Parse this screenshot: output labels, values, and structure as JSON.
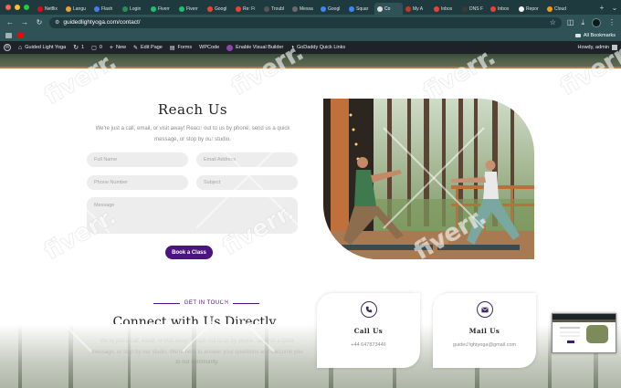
{
  "browser": {
    "tabs": [
      {
        "label": "Netflix",
        "color": "#e50914"
      },
      {
        "label": "Langu",
        "color": "#e8a33b"
      },
      {
        "label": "Flash",
        "color": "#4b7bec"
      },
      {
        "label": "Login",
        "color": "#2e8b57"
      },
      {
        "label": "Fiverr",
        "color": "#1dbf73"
      },
      {
        "label": "Fiverr",
        "color": "#1dbf73"
      },
      {
        "label": "Googl",
        "color": "#ea4335"
      },
      {
        "label": "Re: Fi",
        "color": "#ea4335"
      },
      {
        "label": "Troubl",
        "color": "#555555"
      },
      {
        "label": "Messa",
        "color": "#6b6b6b"
      },
      {
        "label": "Googl",
        "color": "#4285f4"
      },
      {
        "label": "Squar",
        "color": "#3a86ff"
      },
      {
        "label": "Co",
        "color": "#dddddd"
      },
      {
        "label": "My A",
        "color": "#c0392b"
      },
      {
        "label": "Inbox",
        "color": "#ea4335"
      },
      {
        "label": "DNS F",
        "color": "#3a3a3a"
      },
      {
        "label": "Inbox",
        "color": "#ea4335"
      },
      {
        "label": "Repor",
        "color": "#f5f5f5"
      },
      {
        "label": "Cloud",
        "color": "#f39c12"
      }
    ],
    "active_tab_index": 12,
    "url": "guidedlightyoga.com/contact/",
    "all_bookmarks": "All Bookmarks"
  },
  "wp_admin": {
    "site_name": "Guided Light Yoga",
    "updates_count": "1",
    "comments_count": "0",
    "new_label": "New",
    "edit_page": "Edit Page",
    "forms": "Forms",
    "wpcode": "WPCode",
    "visual_builder": "Enable Visual Builder",
    "quick_links": "GoDaddy Quick Links",
    "howdy": "Howdy, admin"
  },
  "contact_form": {
    "title": "Reach Us",
    "description": "We're just a call, email, or visit away! Reach out to us by phone, send us a quick message, or stop by our studio.",
    "full_name_placeholder": "Full Name",
    "email_placeholder": "Email Address",
    "phone_placeholder": "Phone Number",
    "subject_placeholder": "Subject",
    "message_placeholder": "Message",
    "button_label": "Book a Class",
    "button_color": "#4b1480"
  },
  "connect": {
    "eyebrow": "GET IN TOUCH",
    "title": "Connect with Us Directly",
    "description": "We're just a call, email, or visit away! Reach out to us by phone, send us a quick message, or stop by our studio. We're here to answer your questions and welcome you to our community."
  },
  "cards": {
    "call": {
      "title": "Call Us",
      "value": "+44 647873446",
      "icon": "phone-icon"
    },
    "mail": {
      "title": "Mail Us",
      "value": "guidedlightyoga@gmail.com",
      "icon": "envelope-icon"
    }
  },
  "watermark": "fiverr."
}
